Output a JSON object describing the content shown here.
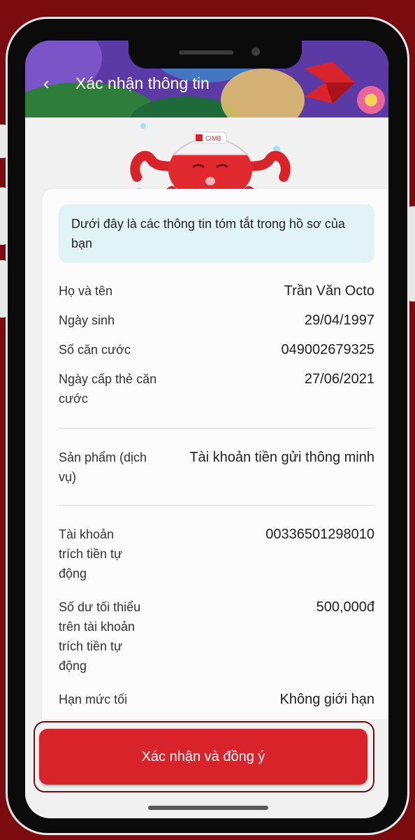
{
  "header": {
    "title": "Xác nhận thông tin",
    "back_icon": "‹"
  },
  "mascot": {
    "brand_text": "CIMB"
  },
  "banner": {
    "text": "Dưới đây là các thông tin tóm tắt trong hồ sơ của bạn"
  },
  "info": [
    {
      "label": "Họ và tên",
      "value": "Trần Văn Octo"
    },
    {
      "label": "Ngày sinh",
      "value": "29/04/1997"
    },
    {
      "label": "Số căn cước",
      "value": "049002679325"
    },
    {
      "label": "Ngày cấp thẻ căn cước",
      "value": "27/06/2021"
    },
    {
      "label": "Sản phẩm (dịch vụ)",
      "value": "Tài khoản tiền gửi thông minh"
    },
    {
      "label": "Tài khoản trích tiền tự động",
      "value": "00336501298010"
    },
    {
      "label": "Số dư tối thiểu trên tài khoản trích tiền tự động",
      "value": "500,000đ"
    },
    {
      "label": "Hạn mức tối",
      "value": "Không giới hạn"
    }
  ],
  "cta": {
    "label": "Xác nhận và đồng ý"
  },
  "colors": {
    "primary": "#d8232a",
    "frame": "#7a0b0f",
    "header": "#5c3aa6",
    "banner": "#e2f3f6"
  }
}
